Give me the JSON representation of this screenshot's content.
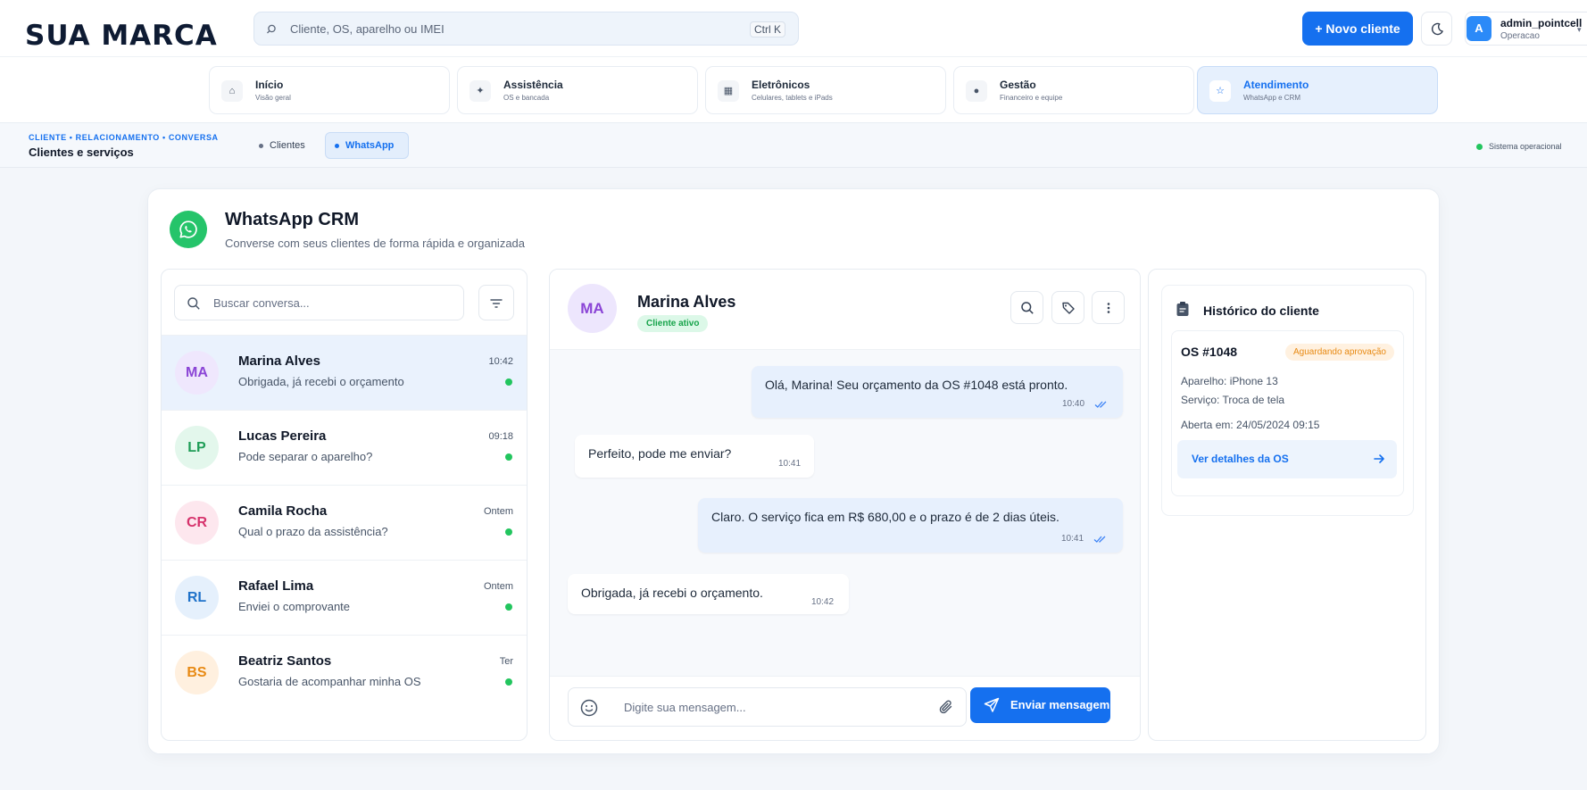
{
  "brand": {
    "logo": "SUA MARCA"
  },
  "header": {
    "search_placeholder": "Cliente, OS, aparelho ou IMEI",
    "search_shortcut": "Ctrl K",
    "new_client_label": "+ Novo cliente",
    "user": {
      "initial": "A",
      "name": "admin_pointcell",
      "role": "Operacao"
    }
  },
  "nav": {
    "items": [
      {
        "title": "Início",
        "subtitle": "Visão geral",
        "icon": "home-icon"
      },
      {
        "title": "Assistência",
        "subtitle": "OS e bancada",
        "icon": "tools-icon"
      },
      {
        "title": "Eletrônicos",
        "subtitle": "Celulares, tablets e iPads",
        "icon": "device-icon"
      },
      {
        "title": "Gestão",
        "subtitle": "Financeiro e equipe",
        "icon": "finance-icon"
      },
      {
        "title": "Atendimento",
        "subtitle": "WhatsApp e CRM",
        "icon": "support-icon"
      }
    ],
    "active": 4
  },
  "subbar": {
    "breadcrumb": "CLIENTE • RELACIONAMENTO • CONVERSA",
    "title": "Clientes e serviços",
    "tabs": [
      "Clientes",
      "WhatsApp"
    ],
    "active_tab": 1,
    "status": "Sistema operacional"
  },
  "crm": {
    "title": "WhatsApp CRM",
    "subtitle": "Converse com seus clientes de forma rápida e organizada",
    "search_placeholder": "Buscar conversa...",
    "conversations": [
      {
        "initials": "MA",
        "name": "Marina Alves",
        "message": "Obrigada, já recebi o orçamento",
        "time": "10:42",
        "bg": "#efe7fd",
        "fg": "#8b45d6"
      },
      {
        "initials": "LP",
        "name": "Lucas Pereira",
        "message": "Pode separar o aparelho?",
        "time": "09:18",
        "bg": "#e3f7ec",
        "fg": "#1f9d57"
      },
      {
        "initials": "CR",
        "name": "Camila Rocha",
        "message": "Qual o prazo da assistência?",
        "time": "Ontem",
        "bg": "#fde7ee",
        "fg": "#d6336c"
      },
      {
        "initials": "RL",
        "name": "Rafael Lima",
        "message": "Enviei o comprovante",
        "time": "Ontem",
        "bg": "#e5f0fc",
        "fg": "#1f72c9"
      },
      {
        "initials": "BS",
        "name": "Beatriz Santos",
        "message": "Gostaria de acompanhar minha OS",
        "time": "Ter",
        "bg": "#fff0df",
        "fg": "#e88a14"
      }
    ]
  },
  "chat": {
    "contact_initials": "MA",
    "contact_name": "Marina Alves",
    "contact_status": "Cliente ativo",
    "messages": [
      {
        "dir": "out",
        "text": "Olá, Marina! Seu orçamento da OS #1048 está pronto.",
        "time": "10:40"
      },
      {
        "dir": "in",
        "text": "Perfeito, pode me enviar?",
        "time": "10:41"
      },
      {
        "dir": "out",
        "text": "Claro. O serviço fica em R$ 680,00 e o prazo é de 2 dias úteis.",
        "time": "10:41"
      },
      {
        "dir": "in",
        "text": "Obrigada, já recebi o orçamento.",
        "time": "10:42"
      }
    ],
    "input_placeholder": "Digite sua mensagem...",
    "send_label": "Enviar mensagem"
  },
  "history": {
    "title": "Histórico do cliente",
    "os_id": "OS #1048",
    "os_status": "Aguardando aprovação",
    "device_line": "Aparelho: iPhone 13",
    "service_line": "Serviço: Troca de tela",
    "opened_line": "Aberta em: 24/05/2024 09:15",
    "details_link": "Ver detalhes da OS"
  },
  "colors": {
    "accent": "#1570ef",
    "whatsapp": "#25c46a",
    "online": "#22c55e"
  }
}
